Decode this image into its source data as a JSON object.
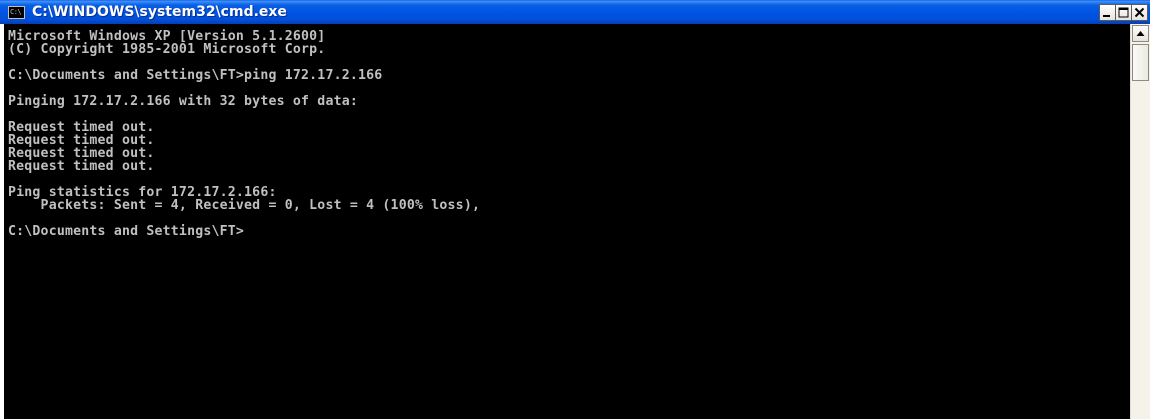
{
  "window": {
    "title": "C:\\WINDOWS\\system32\\cmd.exe",
    "icon": "console-icon",
    "icon_text": "C:\\",
    "colors": {
      "titlebar": "#0054e3",
      "console_background": "#000000",
      "console_text": "#c0c0c0"
    }
  },
  "console": {
    "lines": [
      "Microsoft Windows XP [Version 5.1.2600]",
      "(C) Copyright 1985-2001 Microsoft Corp.",
      "",
      "C:\\Documents and Settings\\FT>ping 172.17.2.166",
      "",
      "Pinging 172.17.2.166 with 32 bytes of data:",
      "",
      "Request timed out.",
      "Request timed out.",
      "Request timed out.",
      "Request timed out.",
      "",
      "Ping statistics for 172.17.2.166:",
      "    Packets: Sent = 4, Received = 0, Lost = 4 (100% loss),",
      "",
      "C:\\Documents and Settings\\FT>"
    ]
  }
}
